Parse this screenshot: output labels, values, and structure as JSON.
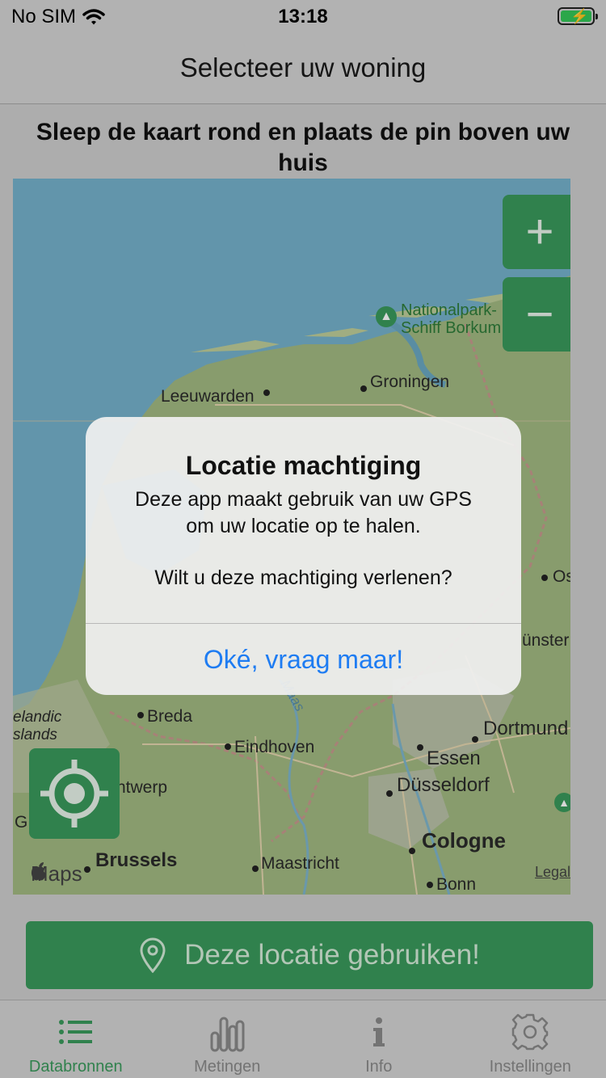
{
  "status": {
    "carrier": "No SIM",
    "time": "13:18"
  },
  "nav": {
    "title": "Selecteer uw woning"
  },
  "instruction": "Sleep de kaart rond en plaats de pin boven uw huis",
  "map": {
    "labels": {
      "park": "Nationalpark-\nSchiff Borkum",
      "groningen": "Groningen",
      "leeuwarden": "Leeuwarden",
      "osna": "Osna",
      "munster": "ünster",
      "dortmund": "Dortmund",
      "essen": "Essen",
      "dusseldorf": "Düsseldorf",
      "cologne": "Cologne",
      "bonn": "Bonn",
      "breda": "Breda",
      "eindhoven": "Eindhoven",
      "antwerp": "ntwerp",
      "brussels": "Brussels",
      "maastricht": "Maastricht",
      "zeeland": "elandic\nslands",
      "g": "G",
      "river": "Maas"
    },
    "zoom_in": "+",
    "zoom_out": "−",
    "maps_brand": "Maps",
    "legal": "Legal",
    "icons": {
      "zoom_in": "plus-icon",
      "zoom_out": "minus-icon",
      "locate": "crosshair-icon",
      "park": "tree-icon"
    }
  },
  "alert": {
    "title": "Locatie machtiging",
    "message_line1": "Deze app maakt gebruik van uw GPS",
    "message_line2": "om uw locatie op te halen.",
    "message_line3": "Wilt u deze machtiging verlenen?",
    "button": "Oké, vraag maar!"
  },
  "cta": {
    "label": "Deze locatie gebruiken!",
    "icon": "location-pin-icon"
  },
  "tabs": [
    {
      "label": "Databronnen",
      "icon": "list-icon",
      "active": true
    },
    {
      "label": "Metingen",
      "icon": "bar-chart-icon",
      "active": false
    },
    {
      "label": "Info",
      "icon": "info-icon",
      "active": false
    },
    {
      "label": "Instellingen",
      "icon": "gear-icon",
      "active": false
    }
  ],
  "colors": {
    "accent": "#3a9a5c",
    "link": "#1e7cf2",
    "water": "#75b2cc",
    "land": "#9bb57d"
  }
}
